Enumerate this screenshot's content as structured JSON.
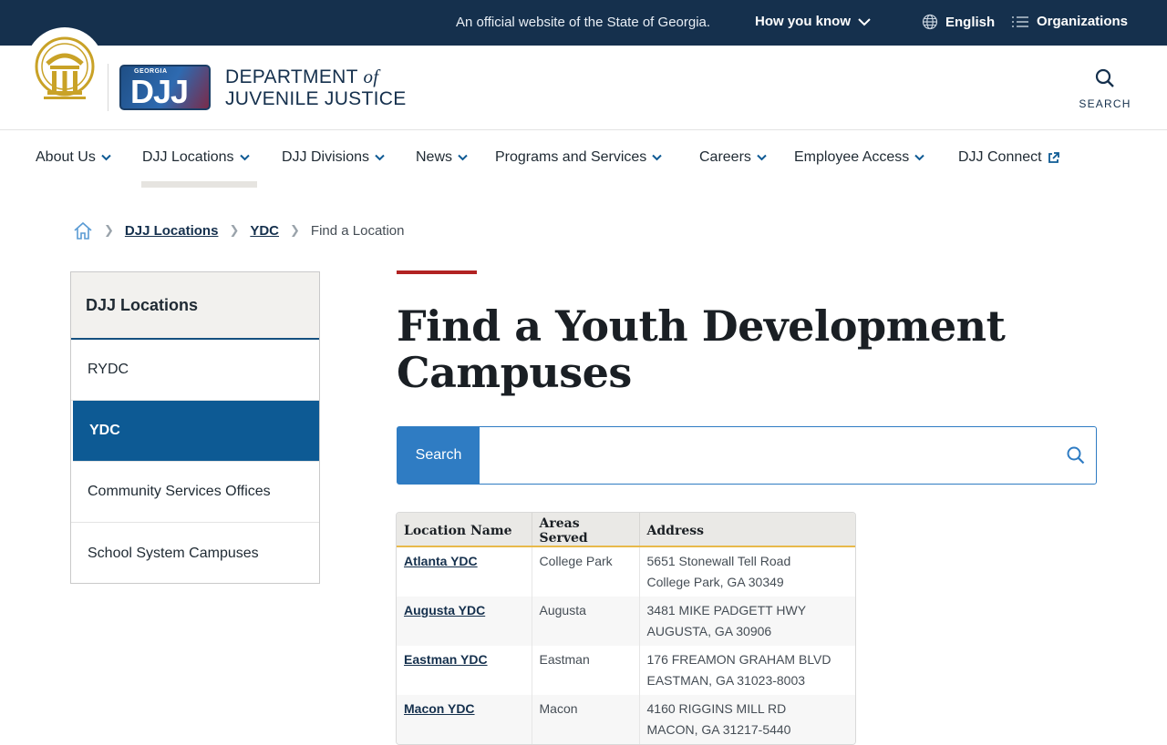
{
  "topbar": {
    "official_text": "An official website of the State of Georgia.",
    "how_you_know": "How you know",
    "language": "English",
    "organizations": "Organizations"
  },
  "header": {
    "logo_small_text": "GEORGIA",
    "logo_mark": "DJJ",
    "dept_line1_a": "DEPARTMENT ",
    "dept_line1_of": "of",
    "dept_line2": "JUVENILE JUSTICE",
    "search_label": "SEARCH"
  },
  "nav": {
    "items": [
      {
        "label": "About Us"
      },
      {
        "label": "DJJ Locations"
      },
      {
        "label": "DJJ Divisions"
      },
      {
        "label": "News"
      },
      {
        "label": "Programs and Services"
      },
      {
        "label": "Careers"
      },
      {
        "label": "Employee Access"
      },
      {
        "label": "DJJ Connect"
      }
    ]
  },
  "breadcrumb": {
    "items": [
      "DJJ Locations",
      "YDC"
    ],
    "current": "Find a Location"
  },
  "sidebar": {
    "title": "DJJ Locations",
    "links": [
      {
        "label": "RYDC",
        "active": false
      },
      {
        "label": "YDC",
        "active": true
      },
      {
        "label": "Community Services Offices",
        "active": false
      },
      {
        "label": "School System Campuses",
        "active": false
      }
    ]
  },
  "content": {
    "title": "Find a Youth Development Campuses",
    "search_label": "Search",
    "search_value": ""
  },
  "table": {
    "headers": [
      "Location Name",
      "Areas Served",
      "Address"
    ],
    "rows": [
      {
        "name": "Atlanta YDC",
        "area": "College Park",
        "addr1": "5651 Stonewall Tell Road",
        "addr2": "College Park, GA 30349"
      },
      {
        "name": "Augusta YDC",
        "area": "Augusta",
        "addr1": "3481 MIKE PADGETT HWY",
        "addr2": "AUGUSTA, GA 30906"
      },
      {
        "name": "Eastman YDC",
        "area": "Eastman",
        "addr1": "176 FREAMON GRAHAM BLVD",
        "addr2": "EASTMAN, GA 31023-8003"
      },
      {
        "name": "Macon YDC",
        "area": "Macon",
        "addr1": "4160 RIGGINS MILL RD",
        "addr2": "MACON, GA 31217-5440"
      }
    ]
  },
  "colors": {
    "topbar_bg": "#15304d",
    "active_sidebar": "#0d5a94",
    "search_accent": "#2f7cc3",
    "title_accent": "#b22222",
    "table_header_rule": "#e8b94a"
  }
}
